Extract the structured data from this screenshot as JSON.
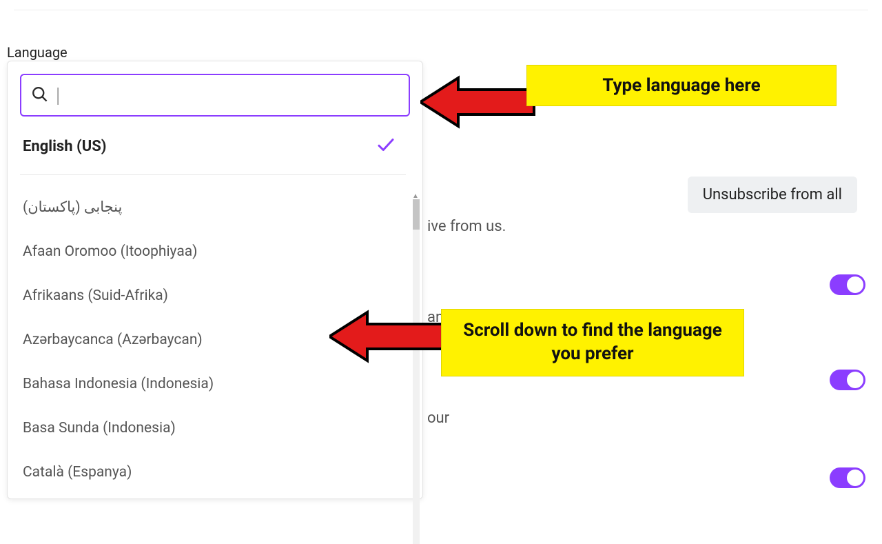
{
  "sectionLabel": "Language",
  "search": {
    "value": "",
    "placeholder": ""
  },
  "selected": "English (US)",
  "languages": [
    "پنجابی (پاکستان)",
    "Afaan Oromoo (Itoophiyaa)",
    "Afrikaans (Suid-Afrika)",
    "Azərbaycanca (Azərbaycan)",
    "Bahasa Indonesia (Indonesia)",
    "Basa Sunda (Indonesia)",
    "Català (Espanya)"
  ],
  "background": {
    "text1": "ive from us.",
    "text2": "andy",
    "text3": "our",
    "unsubscribe": "Unsubscribe from all"
  },
  "callouts": {
    "top": "Type language here",
    "bottom": "Scroll down to find the language you prefer"
  },
  "colors": {
    "accent": "#8b3dff",
    "highlight": "#fff200"
  }
}
